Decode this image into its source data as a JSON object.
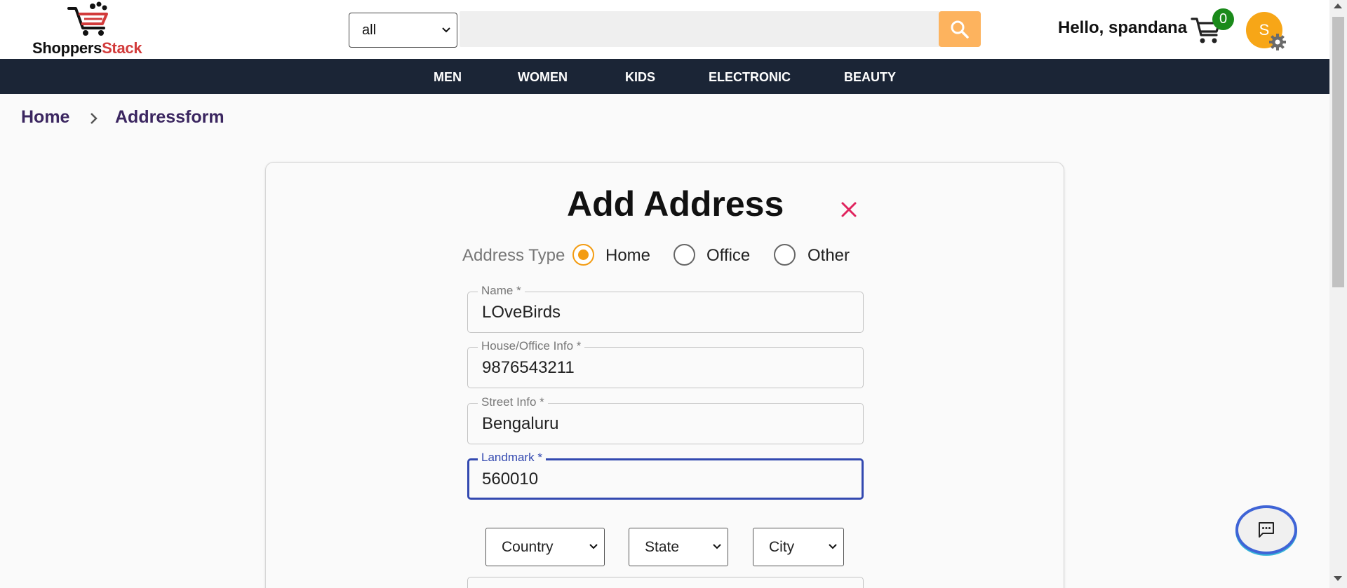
{
  "header": {
    "logo_part1": "Shoppers",
    "logo_part2": "Stack",
    "category_select": "all",
    "search_placeholder": "",
    "greeting": "Hello, spandana",
    "cart_count": "0",
    "avatar_initial": "S"
  },
  "nav": {
    "items": [
      "MEN",
      "WOMEN",
      "KIDS",
      "ELECTRONIC",
      "BEAUTY"
    ]
  },
  "breadcrumb": {
    "home": "Home",
    "current": "Addressform"
  },
  "form": {
    "title": "Add Address",
    "address_type_label": "Address Type",
    "address_types": [
      "Home",
      "Office",
      "Other"
    ],
    "selected_type": "Home",
    "fields": [
      {
        "label": "Name *",
        "value": "LOveBirds"
      },
      {
        "label": "House/Office Info *",
        "value": "9876543211"
      },
      {
        "label": "Street Info *",
        "value": "Bengaluru"
      },
      {
        "label": "Landmark *",
        "value": "560010"
      }
    ],
    "country": "Country",
    "state": "State",
    "city": "City"
  },
  "colors": {
    "nav_bg": "#1b2536",
    "search_button": "#fdb35e",
    "radio_accent": "#f39c12",
    "focus_border": "#3349b0",
    "close_icon": "#e0245e",
    "cart_badge": "#1a8a1a",
    "avatar_bg": "#f7a617"
  }
}
